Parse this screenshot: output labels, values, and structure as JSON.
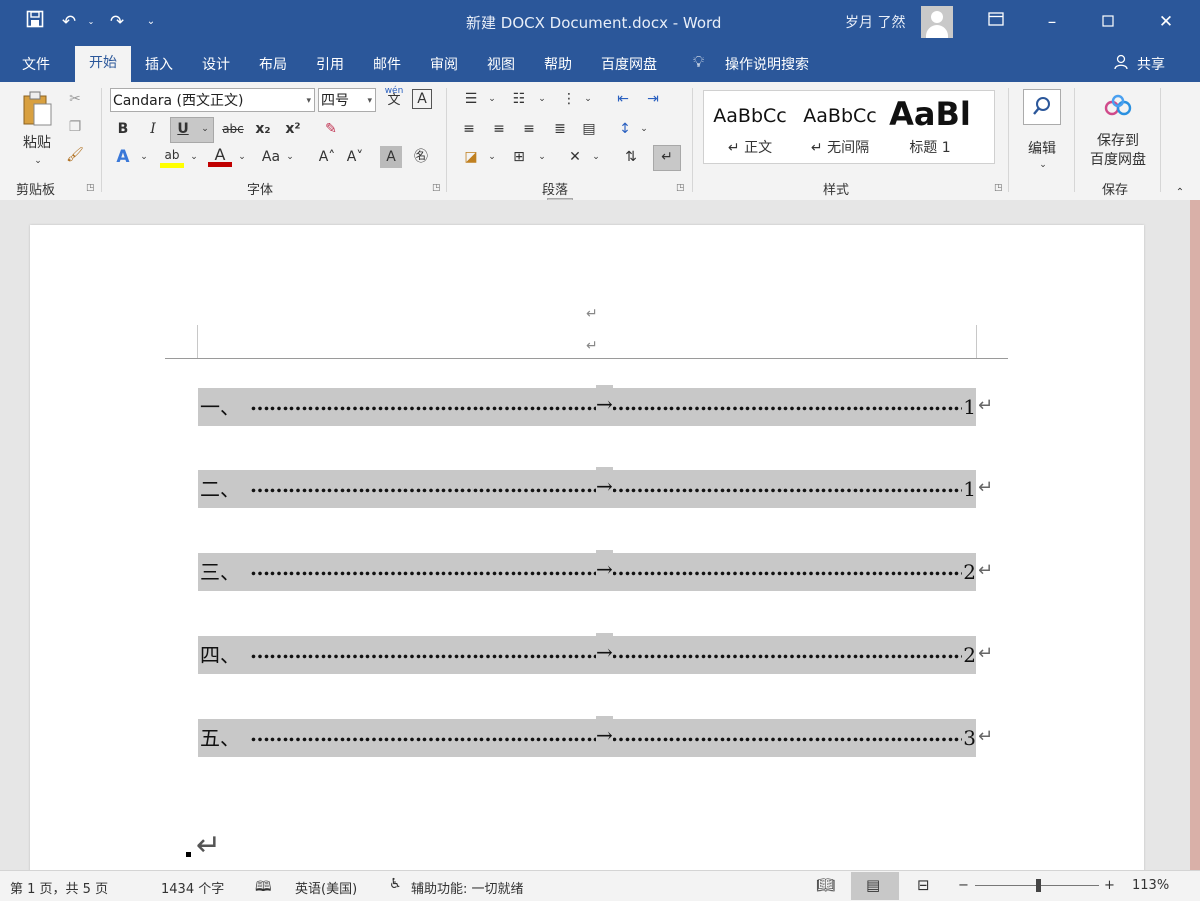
{
  "titlebar": {
    "document_title": "新建 DOCX Document.docx  -  Word",
    "user": "岁月 了然",
    "quick_access": [
      "save-icon",
      "undo-icon",
      "redo-icon",
      "customize-icon"
    ],
    "window_controls": [
      "ribbon-display-icon",
      "minimize-icon",
      "maximize-icon",
      "close-icon"
    ]
  },
  "tabs": {
    "items": [
      "文件",
      "开始",
      "插入",
      "设计",
      "布局",
      "引用",
      "邮件",
      "审阅",
      "视图",
      "帮助",
      "百度网盘"
    ],
    "active": "开始",
    "tell_me": "操作说明搜索",
    "share": "共享"
  },
  "ribbon": {
    "clipboard": {
      "paste": "粘贴",
      "label": "剪贴板"
    },
    "font": {
      "font_name": "Candara (西文正文)",
      "font_size": "四号",
      "bold": "B",
      "italic": "I",
      "underline": "U",
      "strike": "abc",
      "subscript": "x₂",
      "superscript": "x²",
      "change_case": "Aa",
      "grow": "A˄",
      "shrink": "A˅",
      "phonetic": "wén",
      "label": "字体"
    },
    "paragraph": {
      "label": "段落"
    },
    "styles": {
      "items": [
        {
          "preview": "AaBbCc",
          "name": "↵ 正文"
        },
        {
          "preview": "AaBbCc",
          "name": "↵ 无间隔"
        },
        {
          "preview": "AaBl",
          "name": "标题 1"
        }
      ],
      "label": "样式"
    },
    "editing": {
      "label": "编辑"
    },
    "save": {
      "button": "保存到\n百度网盘",
      "label": "保存"
    }
  },
  "document": {
    "header_marks": [
      "↵",
      "↵"
    ],
    "toc": [
      {
        "num": "一、",
        "page": "1"
      },
      {
        "num": "二、",
        "page": "1"
      },
      {
        "num": "三、",
        "page": "2"
      },
      {
        "num": "四、",
        "page": "2"
      },
      {
        "num": "五、",
        "page": "3"
      }
    ],
    "tab_mark": "→",
    "para_mark": "↵"
  },
  "status": {
    "page": "第 1 页，共 5 页",
    "words": "1434 个字",
    "language": "英语(美国)",
    "accessibility": "辅助功能: 一切就绪",
    "zoom": "113%",
    "zoom_minus": "−",
    "zoom_plus": "+"
  }
}
